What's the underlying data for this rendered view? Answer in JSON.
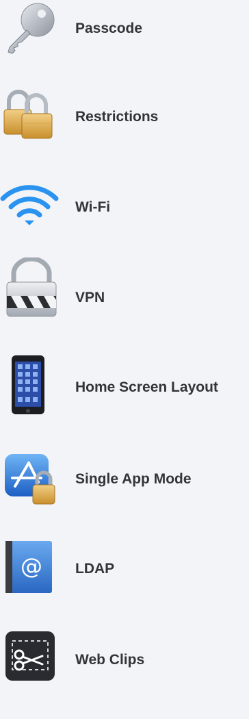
{
  "items": [
    {
      "label": "Passcode",
      "icon": "key-icon"
    },
    {
      "label": "Restrictions",
      "icon": "padlocks-icon"
    },
    {
      "label": "Wi-Fi",
      "icon": "wifi-icon"
    },
    {
      "label": "VPN",
      "icon": "vpn-lock-icon"
    },
    {
      "label": "Home Screen Layout",
      "icon": "phone-icon"
    },
    {
      "label": "Single App Mode",
      "icon": "app-store-lock-icon"
    },
    {
      "label": "LDAP",
      "icon": "address-book-icon"
    },
    {
      "label": "Web Clips",
      "icon": "scissors-icon"
    }
  ]
}
